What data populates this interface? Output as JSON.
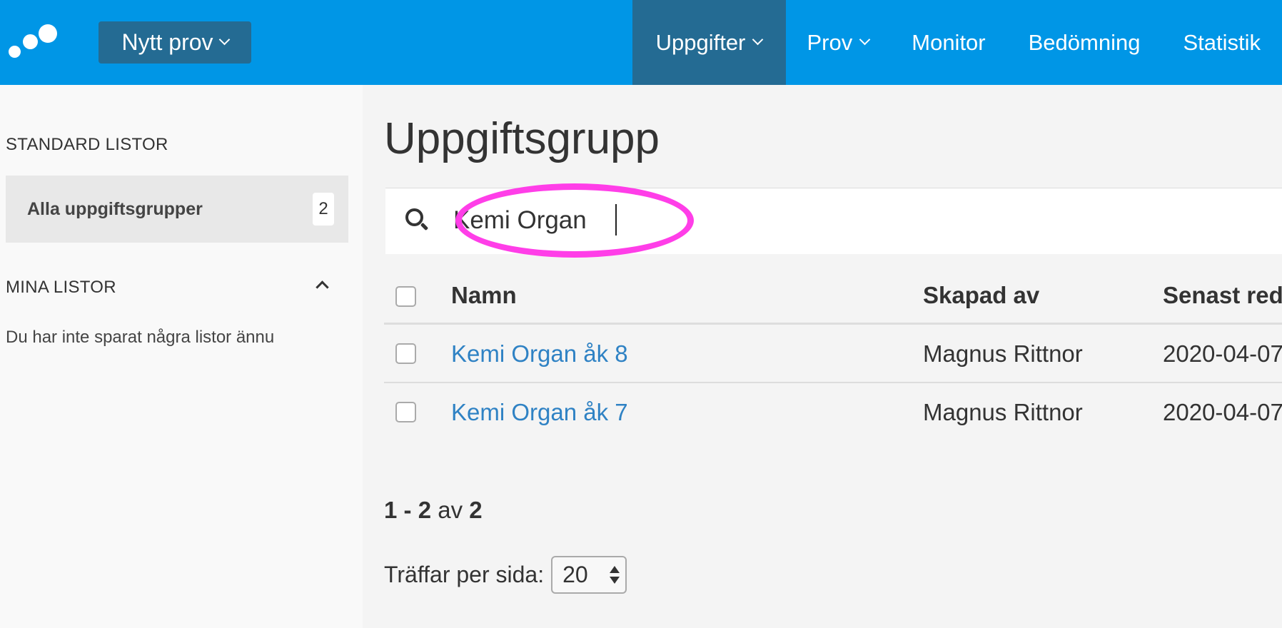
{
  "header": {
    "logo_icon": "dots-logo-icon",
    "new_button_label": "Nytt prov",
    "nav": [
      {
        "label": "Uppgifter",
        "dropdown": true,
        "active": true
      },
      {
        "label": "Prov",
        "dropdown": true,
        "active": false
      },
      {
        "label": "Monitor",
        "dropdown": false,
        "active": false
      },
      {
        "label": "Bedömning",
        "dropdown": false,
        "active": false
      },
      {
        "label": "Statistik",
        "dropdown": false,
        "active": false
      }
    ],
    "colors": {
      "bar": "#0096e6",
      "active": "#246b93"
    }
  },
  "sidebar": {
    "standard_heading": "STANDARD LISTOR",
    "items": [
      {
        "label": "Alla uppgiftsgrupper",
        "count": "2"
      }
    ],
    "my_lists_heading": "MINA LISTOR",
    "empty_text": "Du har inte sparat några listor ännu"
  },
  "main": {
    "title": "Uppgiftsgrupp",
    "search": {
      "value": "Kemi Organ",
      "placeholder": ""
    },
    "table": {
      "columns": [
        "Namn",
        "Skapad av",
        "Senast red"
      ],
      "rows": [
        {
          "name": "Kemi Organ åk 8",
          "created_by": "Magnus Rittnor",
          "date": "2020-04-07"
        },
        {
          "name": "Kemi Organ åk 7",
          "created_by": "Magnus Rittnor",
          "date": "2020-04-07"
        }
      ]
    },
    "pagination": {
      "from": "1",
      "to": "2",
      "sep": "-",
      "of_label": "av",
      "total": "2"
    },
    "per_page": {
      "label": "Träffar per sida:",
      "value": "20"
    }
  },
  "annotation": {
    "highlight_color": "#ff3ee8"
  }
}
